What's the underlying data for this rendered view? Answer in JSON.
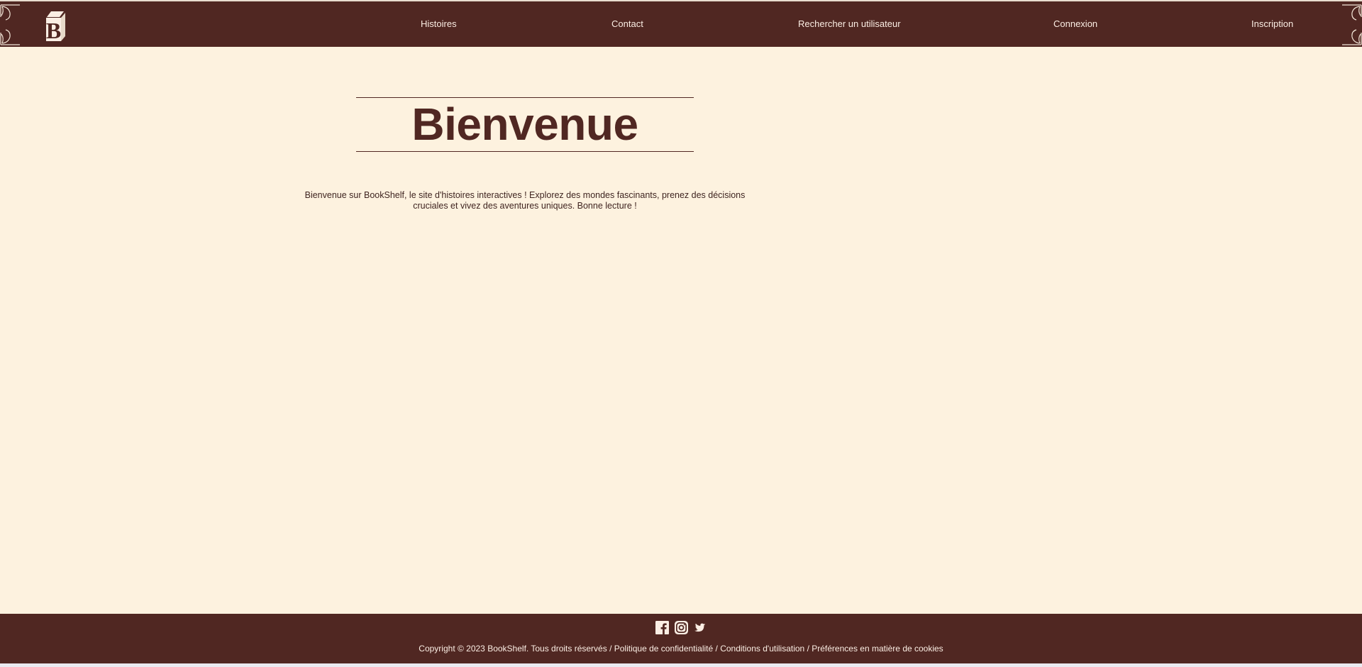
{
  "brand": {
    "logo_icon": "book-b-logo-icon"
  },
  "nav": {
    "items": [
      {
        "label": "Histoires"
      },
      {
        "label": "Contact"
      },
      {
        "label": "Rechercher un utilisateur"
      },
      {
        "label": "Connexion"
      },
      {
        "label": "Inscription"
      }
    ]
  },
  "main": {
    "title": "Bienvenue",
    "intro": "Bienvenue sur BookShelf, le site d'histoires interactives ! Explorez des mondes fascinants, prenez des décisions cruciales et vivez des aventures uniques. Bonne lecture !"
  },
  "footer": {
    "socials": [
      {
        "icon": "facebook-icon"
      },
      {
        "icon": "instagram-icon"
      },
      {
        "icon": "twitter-icon"
      }
    ],
    "copyright": "Copyright © 2023 BookShelf. Tous droits réservés",
    "sep": " / ",
    "links": [
      {
        "label": "Politique de confidentialité"
      },
      {
        "label": "Conditions d'utilisation"
      },
      {
        "label": "Préférences en matière de cookies"
      }
    ]
  },
  "colors": {
    "primary": "#502722",
    "background": "#fdf2df",
    "text_light": "#fbeee4"
  }
}
